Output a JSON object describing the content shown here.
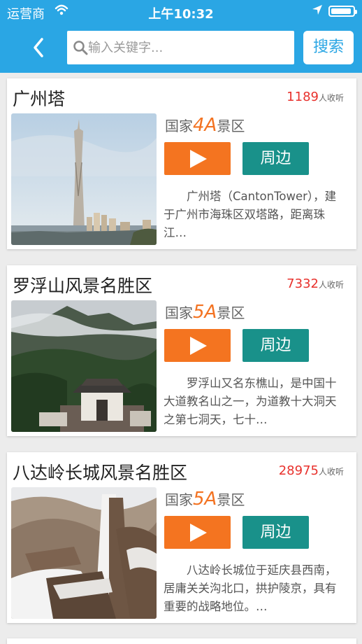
{
  "status_bar": {
    "carrier": "运营商",
    "time": "上午10:32",
    "icons": [
      "wifi-icon",
      "location-arrow-icon",
      "battery-icon"
    ]
  },
  "nav": {
    "back_icon": "chevron-left-icon",
    "search_placeholder": "输入关键字...",
    "search_icon": "magnifier-icon",
    "search_button": "搜索"
  },
  "colors": {
    "header": "#2aa6e4",
    "play_button": "#f47420",
    "around_button": "#19918a",
    "count": "#e8312c",
    "grade_level": "#f37322"
  },
  "cards": [
    {
      "title": "广州塔",
      "count": "1189",
      "count_suffix": "人收听",
      "grade_prefix": "国家",
      "grade_level": "4A",
      "grade_suffix": "景区",
      "around_label": "周边",
      "description": "广州塔（CantonTower），建于广州市海珠区双塔路，距离珠江…"
    },
    {
      "title": "罗浮山风景名胜区",
      "count": "7332",
      "count_suffix": "人收听",
      "grade_prefix": "国家",
      "grade_level": "5A",
      "grade_suffix": "景区",
      "around_label": "周边",
      "description": "罗浮山又名东樵山，是中国十大道教名山之一，为道教十大洞天之第七洞天，七十…"
    },
    {
      "title": "八达岭长城风景名胜区",
      "count": "28975",
      "count_suffix": "人收听",
      "grade_prefix": "国家",
      "grade_level": "5A",
      "grade_suffix": "景区",
      "around_label": "周边",
      "description": "八达岭长城位于延庆县西南，居庸关关沟北口，拱护陵京，具有重要的战略地位。…"
    }
  ]
}
